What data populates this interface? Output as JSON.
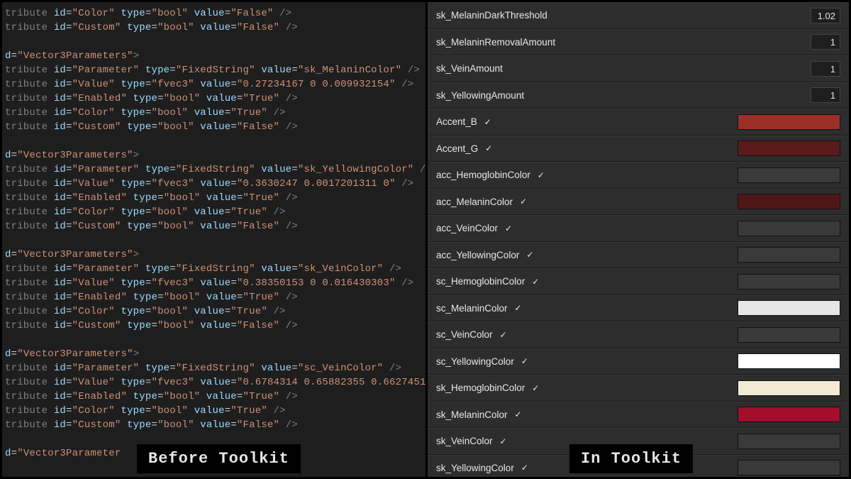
{
  "captions": {
    "left": "Before Toolkit",
    "right": "In Toolkit"
  },
  "code": {
    "blocks": [
      {
        "header": null,
        "lines": [
          {
            "n": "tribute",
            "id": "Color",
            "type": "bool",
            "value": "False"
          },
          {
            "n": "tribute",
            "id": "Custom",
            "type": "bool",
            "value": "False"
          }
        ]
      },
      {
        "header": "d=\"Vector3Parameters\">",
        "lines": [
          {
            "n": "tribute",
            "id": "Parameter",
            "type": "FixedString",
            "value": "sk_MelaninColor"
          },
          {
            "n": "tribute",
            "id": "Value",
            "type": "fvec3",
            "value": "0.27234167 0 0.009932154"
          },
          {
            "n": "tribute",
            "id": "Enabled",
            "type": "bool",
            "value": "True"
          },
          {
            "n": "tribute",
            "id": "Color",
            "type": "bool",
            "value": "True"
          },
          {
            "n": "tribute",
            "id": "Custom",
            "type": "bool",
            "value": "False"
          }
        ]
      },
      {
        "header": "d=\"Vector3Parameters\">",
        "lines": [
          {
            "n": "tribute",
            "id": "Parameter",
            "type": "FixedString",
            "value": "sk_YellowingColor"
          },
          {
            "n": "tribute",
            "id": "Value",
            "type": "fvec3",
            "value": "0.3630247 0.0017201311 0"
          },
          {
            "n": "tribute",
            "id": "Enabled",
            "type": "bool",
            "value": "True"
          },
          {
            "n": "tribute",
            "id": "Color",
            "type": "bool",
            "value": "True"
          },
          {
            "n": "tribute",
            "id": "Custom",
            "type": "bool",
            "value": "False"
          }
        ]
      },
      {
        "header": "d=\"Vector3Parameters\">",
        "lines": [
          {
            "n": "tribute",
            "id": "Parameter",
            "type": "FixedString",
            "value": "sk_VeinColor"
          },
          {
            "n": "tribute",
            "id": "Value",
            "type": "fvec3",
            "value": "0.38350153 0 0.016430303"
          },
          {
            "n": "tribute",
            "id": "Enabled",
            "type": "bool",
            "value": "True"
          },
          {
            "n": "tribute",
            "id": "Color",
            "type": "bool",
            "value": "True"
          },
          {
            "n": "tribute",
            "id": "Custom",
            "type": "bool",
            "value": "False"
          }
        ]
      },
      {
        "header": "d=\"Vector3Parameters\">",
        "lines": [
          {
            "n": "tribute",
            "id": "Parameter",
            "type": "FixedString",
            "value": "sc_VeinColor"
          },
          {
            "n": "tribute",
            "id": "Value",
            "type": "fvec3",
            "value": "0.6784314 0.65882355 0.6627451"
          },
          {
            "n": "tribute",
            "id": "Enabled",
            "type": "bool",
            "value": "True"
          },
          {
            "n": "tribute",
            "id": "Color",
            "type": "bool",
            "value": "True"
          },
          {
            "n": "tribute",
            "id": "Custom",
            "type": "bool",
            "value": "False"
          }
        ]
      },
      {
        "header": "d=\"Vector3Parameter",
        "lines": []
      }
    ]
  },
  "toolkit": {
    "rows": [
      {
        "kind": "num",
        "label": "sk_MelaninDarkThreshold",
        "value": "1.02"
      },
      {
        "kind": "num",
        "label": "sk_MelaninRemovalAmount",
        "value": "1"
      },
      {
        "kind": "num",
        "label": "sk_VeinAmount",
        "value": "1"
      },
      {
        "kind": "num",
        "label": "sk_YellowingAmount",
        "value": "1"
      },
      {
        "kind": "color",
        "label": "Accent_B",
        "checked": true,
        "swatch": "#9c3028"
      },
      {
        "kind": "color",
        "label": "Accent_G",
        "checked": true,
        "swatch": "#5a1a1a"
      },
      {
        "kind": "color",
        "label": "acc_HemoglobinColor",
        "checked": true,
        "swatch": "#3a3a3a"
      },
      {
        "kind": "color",
        "label": "acc_MelaninColor",
        "checked": true,
        "swatch": "#4e1616"
      },
      {
        "kind": "color",
        "label": "acc_VeinColor",
        "checked": true,
        "swatch": "#3a3a3a"
      },
      {
        "kind": "color",
        "label": "acc_YellowingColor",
        "checked": true,
        "swatch": "#3a3a3a"
      },
      {
        "kind": "color",
        "label": "sc_HemoglobinColor",
        "checked": true,
        "swatch": "#3a3a3a"
      },
      {
        "kind": "color",
        "label": "sc_MelaninColor",
        "checked": true,
        "swatch": "#e6e6e6"
      },
      {
        "kind": "color",
        "label": "sc_VeinColor",
        "checked": true,
        "swatch": "#3a3a3a"
      },
      {
        "kind": "color",
        "label": "sc_YellowingColor",
        "checked": true,
        "swatch": "#ffffff"
      },
      {
        "kind": "color",
        "label": "sk_HemoglobinColor",
        "checked": true,
        "swatch": "#f2ead3"
      },
      {
        "kind": "color",
        "label": "sk_MelaninColor",
        "checked": true,
        "swatch": "#a30e2c"
      },
      {
        "kind": "color",
        "label": "sk_VeinColor",
        "checked": true,
        "swatch": "#3a3a3a"
      },
      {
        "kind": "color",
        "label": "sk_YellowingColor",
        "checked": true,
        "swatch": "#3a3a3a"
      }
    ]
  }
}
